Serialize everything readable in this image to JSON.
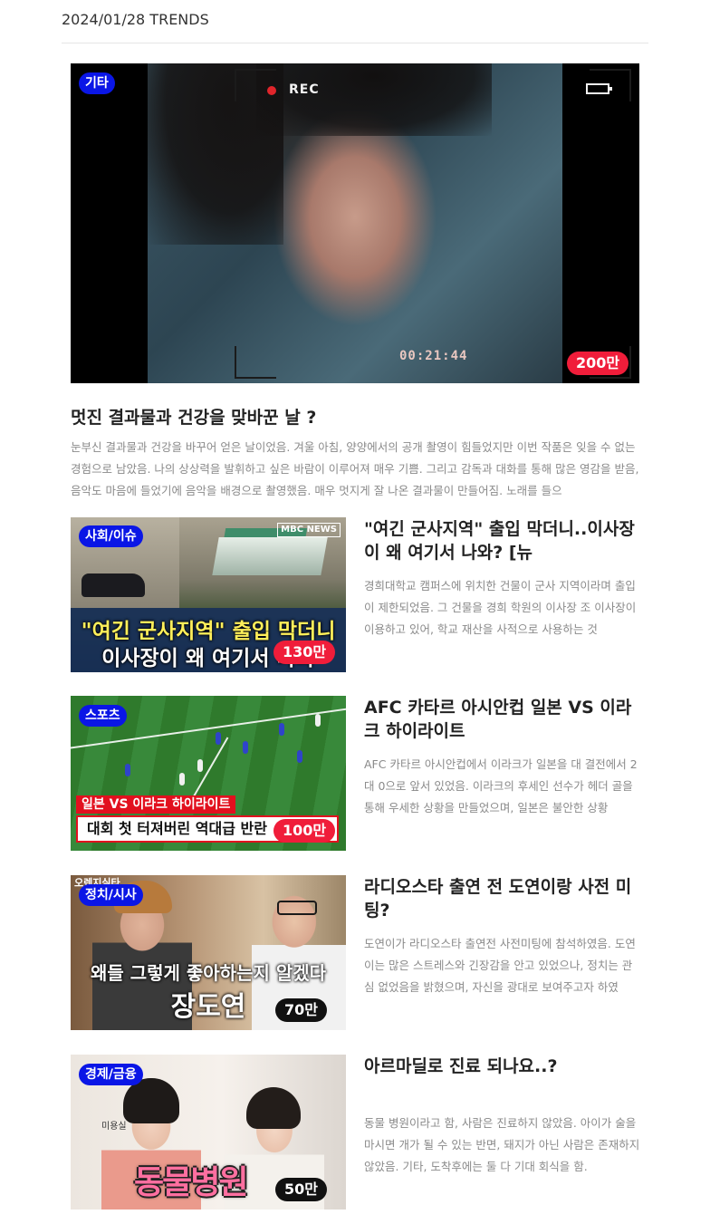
{
  "header": {
    "date_label": "2024/01/28 TRENDS"
  },
  "featured": {
    "category": "기타",
    "views": "200만",
    "overlay_rec": "REC",
    "overlay_timecode": "00:21:44",
    "title": "멋진 결과물과 건강을 맞바꾼 날 ?",
    "description": "눈부신 결과물과 건강을 바꾸어 얻은 날이었음. 겨울 아침, 양양에서의 공개 촬영이 힘들었지만 이번 작품은 잊을 수 없는 경험으로 남았음. 나의 상상력을 발휘하고 싶은 바람이 이루어져 매우 기쁨. 그리고 감독과 대화를 통해 많은 영감을 받음, 음악도 마음에 들었기에 음악을 배경으로 촬영했음. 매우 멋지게 잘 나온 결과물이 만들어짐. 노래를 들으"
  },
  "items": [
    {
      "category": "사회/이슈",
      "views": "130만",
      "thumb_caption_1": "\"여긴 군사지역\" 출입 막더니",
      "thumb_caption_2": "이사장이 왜 여기서 나와",
      "thumb_logo": "MBC NEWS",
      "title": "\"여긴 군사지역\" 출입 막더니..이사장이 왜 여기서 나와? [뉴",
      "description": "경희대학교 캠퍼스에 위치한 건물이 군사 지역이라며 출입이 제한되었음. 그 건물을 경희 학원의 이사장 조 이사장이 이용하고 있어, 학교 재산을 사적으로 사용하는 것"
    },
    {
      "category": "스포츠",
      "views": "100만",
      "thumb_caption_1": "일본 VS 이라크 하이라이트",
      "thumb_caption_2": "대회 첫 터져버린 역대급 반란",
      "title": "AFC 카타르 아시안컵 일본 VS 이라크 하이라이트",
      "description": "AFC 카타르 아시안컵에서 이라크가 일본을 대 결전에서 2대 0으로 앞서 있었음. 이라크의 후세인 선수가 헤더 골을 통해 우세한 상황을 만들었으며, 일본은 불안한 상황"
    },
    {
      "category": "정치/시사",
      "views": "70만",
      "thumb_caption_1": "왜들 그렇게 좋아하는지 알겠다",
      "thumb_caption_2": "장도연",
      "thumb_logo": "오렌지실타",
      "title": "라디오스타 출연 전 도연이랑 사전 미팅?",
      "description": "도연이가 라디오스타 출연전 사전미팅에 참석하였음. 도연이는 많은 스트레스와 긴장감을 안고 있었으나, 정치는 관심 없었음을 밝혔으며, 자신을 광대로 보여주고자 하였"
    },
    {
      "category": "경제/금융",
      "views": "50만",
      "thumb_caption_1": "동물병원",
      "thumb_sign": "미용실",
      "title": "아르마딜로 진료 되나요..?",
      "description": "동물 병원이라고 함, 사람은 진료하지 않았음. 아이가 술을 마시면 개가 될 수 있는 반면, 돼지가 아닌 사람은 존재하지 않았음. 기타, 도착후에는 둘 다 기대 회식을 함."
    }
  ],
  "colors": {
    "category_badge": "#0a16e6",
    "views_badge_red": "#f01d3a",
    "views_badge_black": "#111111",
    "title_text": "#222222",
    "desc_text": "#8a8a8a"
  }
}
